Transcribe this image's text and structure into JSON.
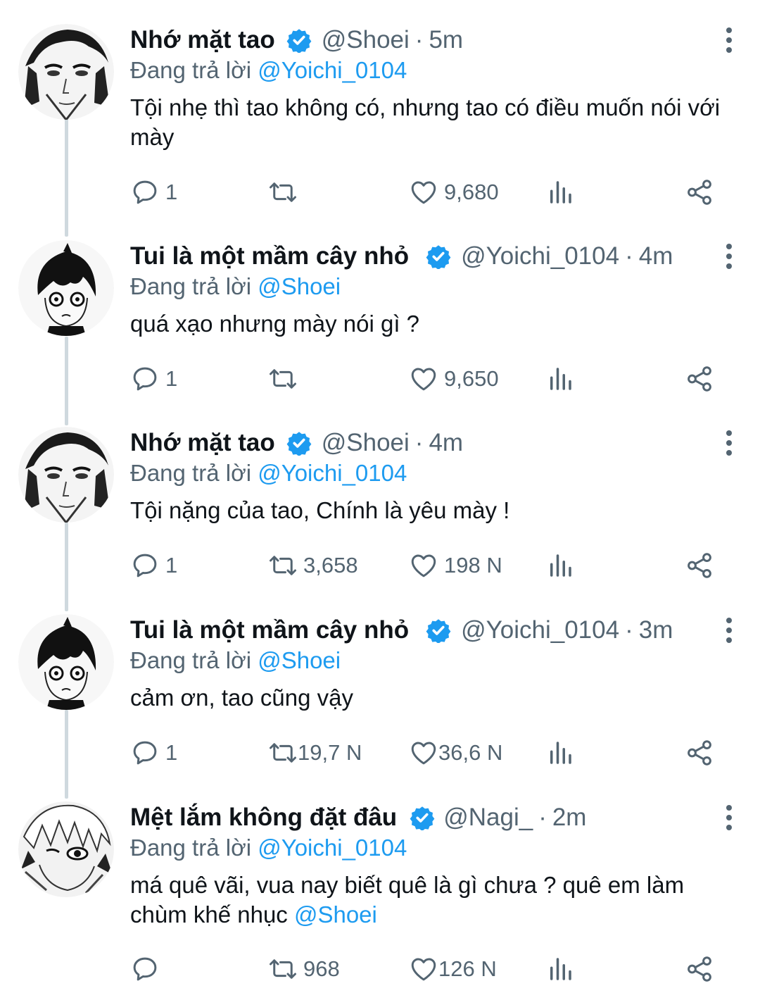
{
  "colors": {
    "accent": "#1d9bf0",
    "secondary_text": "#536471",
    "primary_text": "#0f1419",
    "thread_line": "#cfd9de"
  },
  "reply_prefix": "Đang trả lời",
  "tweets": [
    {
      "avatar": "shoei-avatar",
      "name": "Nhớ mặt tao",
      "handle": "@Shoei",
      "sep": "·",
      "time": "5m",
      "replying_to": "@Yoichi_0104",
      "text": "Tội nhẹ thì tao không có, nhưng tao có điều muốn nói với mày",
      "mention": "",
      "replies": "1",
      "retweets": "",
      "likes": "9,680"
    },
    {
      "avatar": "yoichi-avatar",
      "name": "Tui là một mầm cây nhỏ",
      "handle": "@Yoichi_0104",
      "sep": "·",
      "time": "4m",
      "replying_to": "@Shoei",
      "text": "quá xạo nhưng mày nói gì ?",
      "mention": "",
      "replies": "1",
      "retweets": "",
      "likes": "9,650"
    },
    {
      "avatar": "shoei-avatar",
      "name": "Nhớ mặt tao",
      "handle": "@Shoei",
      "sep": "·",
      "time": "4m",
      "replying_to": "@Yoichi_0104",
      "text": "Tội nặng của tao, Chính là yêu mày !",
      "mention": "",
      "replies": "1",
      "retweets": "3,658",
      "likes": "198 N"
    },
    {
      "avatar": "yoichi-avatar",
      "name": "Tui là một mầm cây nhỏ",
      "handle": "@Yoichi_0104",
      "sep": "·",
      "time": "3m",
      "replying_to": "@Shoei",
      "text": "cảm ơn, tao cũng vậy",
      "mention": "",
      "replies": "1",
      "retweets": "19,7 N",
      "likes": "36,6 N"
    },
    {
      "avatar": "nagi-avatar",
      "name": "Mệt lắm không đặt đâu",
      "handle": "@Nagi_",
      "sep": "·",
      "time": "2m",
      "replying_to": "@Yoichi_0104",
      "text": "má quê vãi, vua nay biết quê là gì chưa ? quê em làm chùm khế nhục ",
      "mention": "@Shoei",
      "replies": "",
      "retweets": "968",
      "likes": "126 N"
    }
  ]
}
